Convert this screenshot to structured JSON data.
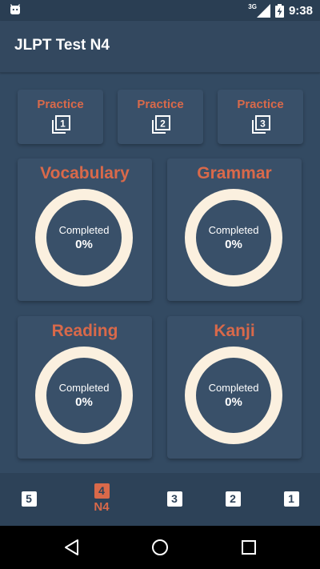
{
  "status_bar": {
    "network": "3G",
    "time": "9:38",
    "icons": [
      "android-debug-icon",
      "signal-icon",
      "battery-charging-icon"
    ]
  },
  "app_bar": {
    "title": "JLPT Test N4"
  },
  "practice": [
    {
      "label": "Practice",
      "number": "1",
      "icon": "filter-1-icon"
    },
    {
      "label": "Practice",
      "number": "2",
      "icon": "filter-2-icon"
    },
    {
      "label": "Practice",
      "number": "3",
      "icon": "filter-3-icon"
    }
  ],
  "sections": [
    {
      "title": "Vocabulary",
      "caption": "Completed",
      "value": "0%",
      "progress": 0
    },
    {
      "title": "Grammar",
      "caption": "Completed",
      "value": "0%",
      "progress": 0
    },
    {
      "title": "Reading",
      "caption": "Completed",
      "value": "0%",
      "progress": 0
    },
    {
      "title": "Kanji",
      "caption": "Completed",
      "value": "0%",
      "progress": 0
    }
  ],
  "levels": {
    "items": [
      {
        "badge": "5"
      },
      {
        "badge": "4",
        "label": "N4",
        "active": true
      },
      {
        "badge": "3"
      },
      {
        "badge": "2"
      },
      {
        "badge": "1"
      }
    ]
  },
  "nav": {
    "icons": [
      "back-icon",
      "home-icon",
      "recents-icon"
    ]
  },
  "colors": {
    "background": "#334a62",
    "card": "#395069",
    "accent": "#d9694a",
    "ring": "#fbf0df",
    "level_bar": "#2d4258"
  }
}
